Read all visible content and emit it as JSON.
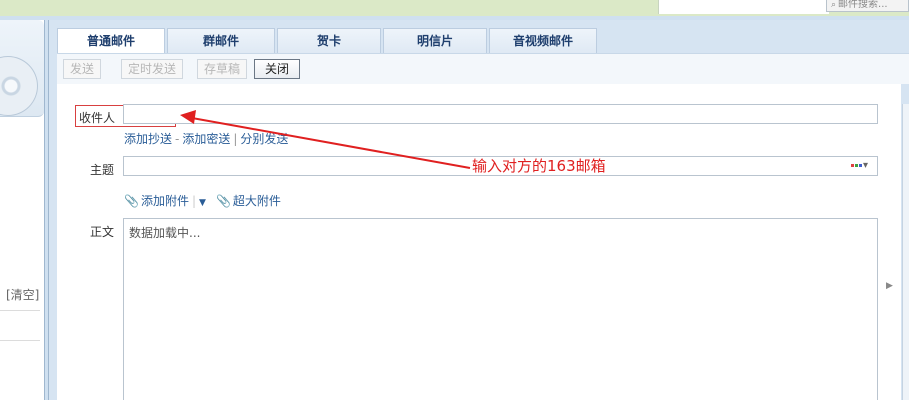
{
  "topbar": {
    "search_placeholder": "邮件搜索..."
  },
  "sidebar": {
    "clear_link": "[清空]"
  },
  "tabs": [
    "普通邮件",
    "群邮件",
    "贺卡",
    "明信片",
    "音视频邮件"
  ],
  "toolbar": {
    "send": "发送",
    "scheduled_send": "定时发送",
    "save_draft": "存草稿",
    "close": "关闭"
  },
  "compose": {
    "recipient_label": "收件人",
    "recipient_value": "",
    "add_cc": "添加抄送",
    "add_bcc": "添加密送",
    "separate_send": "分别发送",
    "subject_label": "主题",
    "subject_value": "",
    "add_attachment": "添加附件",
    "large_attachment": "超大附件",
    "body_label": "正文",
    "body_placeholder": "数据加载中..."
  },
  "annotation": {
    "text": "输入对方的163邮箱",
    "color": "#e02020"
  },
  "colors": {
    "accent": "#2a5d97",
    "annotation": "#e02020",
    "frame": "#9fb7cf"
  }
}
